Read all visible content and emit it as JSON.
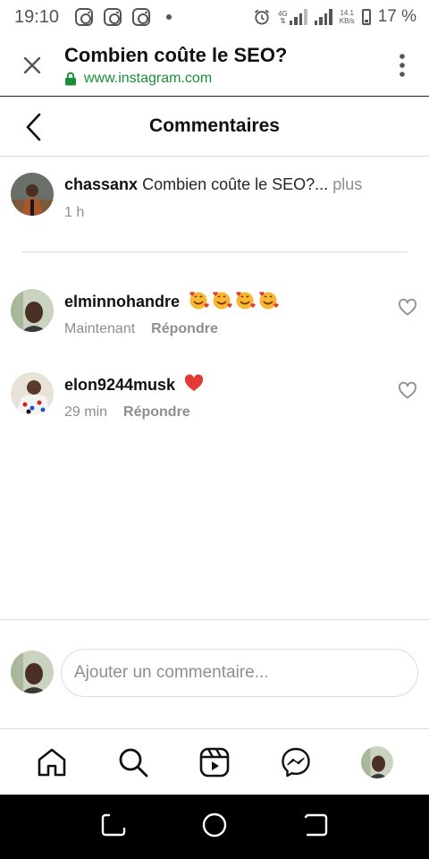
{
  "status_bar": {
    "time": "19:10",
    "network_tag": "4G",
    "speed_value": "14.1",
    "speed_unit": "KB/s",
    "battery_percent": "17 %"
  },
  "browser": {
    "title": "Combien coûte le SEO?",
    "url": "www.instagram.com",
    "url_color": "#1a8f3a"
  },
  "header": {
    "title": "Commentaires"
  },
  "caption": {
    "username": "chassanx",
    "text": "Combien coûte le SEO?...",
    "more_label": "plus",
    "time": "1 h"
  },
  "comments": [
    {
      "username": "elminnohandre",
      "emoji": [
        "smiling-face-with-hearts",
        "smiling-face-with-hearts",
        "smiling-face-with-hearts",
        "smiling-face-with-hearts"
      ],
      "time": "Maintenant",
      "reply_label": "Répondre"
    },
    {
      "username": "elon9244musk",
      "emoji": [
        "red-heart"
      ],
      "time": "29 min",
      "reply_label": "Répondre"
    }
  ],
  "comment_input": {
    "placeholder": "Ajouter un commentaire..."
  },
  "colors": {
    "text_primary": "#262626",
    "text_secondary": "#8e8e8e",
    "divider": "#dbdbdb",
    "heart_red": "#ed4956"
  }
}
